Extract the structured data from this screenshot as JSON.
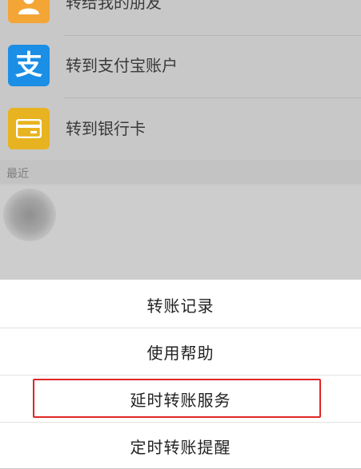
{
  "options": [
    {
      "label": "转给我的朋友",
      "icon": "person-icon",
      "color": "#f3a536"
    },
    {
      "label": "转到支付宝账户",
      "icon": "alipay-icon",
      "color": "#1b8ee6"
    },
    {
      "label": "转到银行卡",
      "icon": "bank-card-icon",
      "color": "#e8b320"
    }
  ],
  "recent_label": "最近",
  "sheet": [
    {
      "label": "转账记录"
    },
    {
      "label": "使用帮助"
    },
    {
      "label": "延时转账服务",
      "highlighted": true
    },
    {
      "label": "定时转账提醒"
    }
  ],
  "highlight_color": "#e02525",
  "alipay_glyph": "支"
}
